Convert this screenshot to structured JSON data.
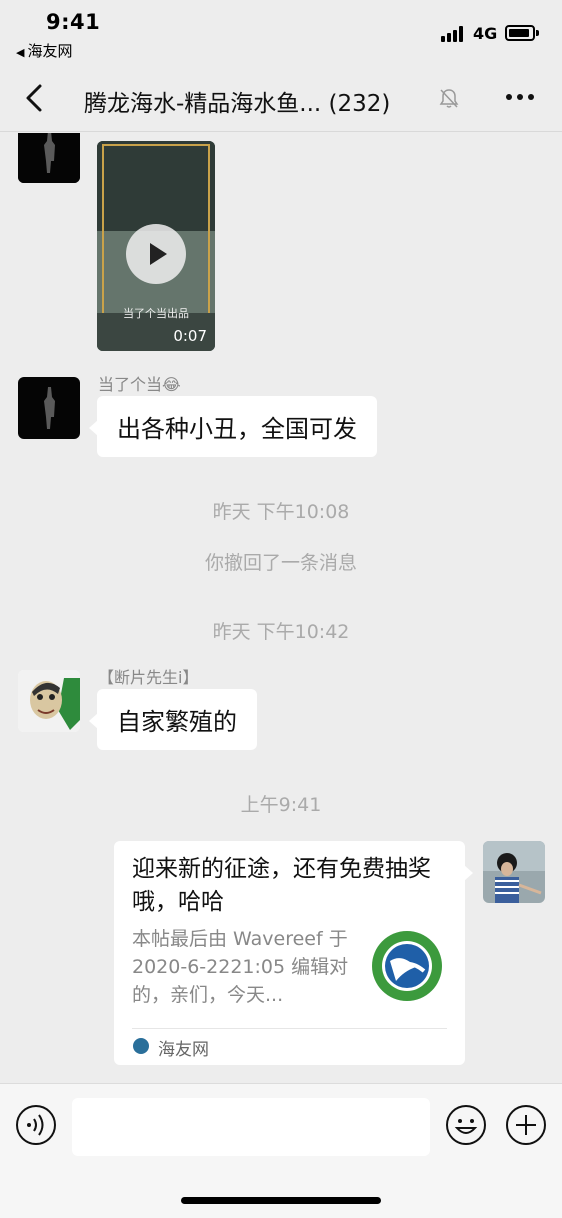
{
  "status_bar": {
    "time": "9:41",
    "back_app": "海友网",
    "network": "4G"
  },
  "nav": {
    "title": "腾龙海水-精品海水鱼...",
    "member_count": "(232)"
  },
  "messages": {
    "video": {
      "caption": "当了个当出品",
      "duration": "0:07"
    },
    "msg1": {
      "sender": "当了个当😂",
      "text": "出各种小丑，全国可发"
    },
    "time1": "昨天 下午10:08",
    "recall": "你撤回了一条消息",
    "time2": "昨天 下午10:42",
    "msg2": {
      "sender": "【断片先生i】",
      "text": "自家繁殖的"
    },
    "time3": "上午9:41",
    "card": {
      "title": "迎来新的征途，还有免费抽奖哦，哈哈",
      "description": "本帖最后由 Wavereef 于 2020-6-2221:05 编辑对的，亲们，今天...",
      "source": "海友网"
    }
  },
  "input": {
    "placeholder": ""
  },
  "colors": {
    "background": "#ededed",
    "bubble": "#ffffff",
    "system_text": "#aaaaaa",
    "sender_text": "#888888"
  }
}
